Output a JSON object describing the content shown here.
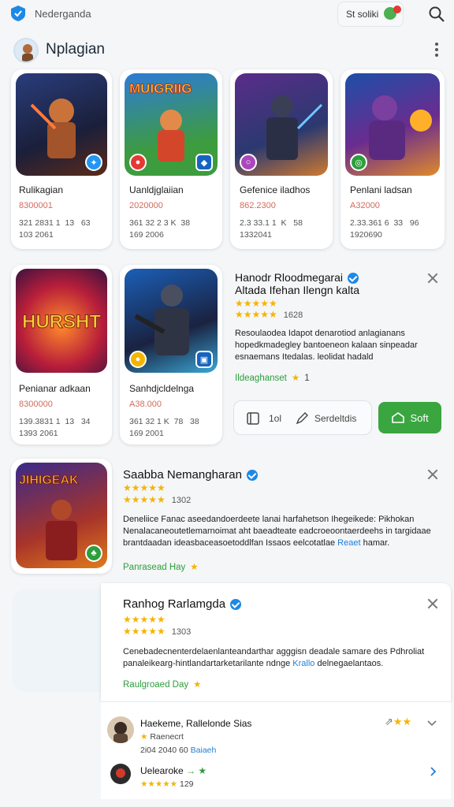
{
  "topbar": {
    "app_name": "Nederganda",
    "pill_label": "St soliki",
    "colors": {
      "accent": "#1e88e5",
      "green": "#3aa63f"
    }
  },
  "header": {
    "title": "Nplagian"
  },
  "grid": [
    {
      "title": "Rulikagian",
      "sub": "8300001",
      "meta": "321 2831 1  13   63\n103 2061"
    },
    {
      "title": "Uanldjglaiian",
      "sub": "2020000",
      "meta": "361 32 2 3 K  38\n169 2006"
    },
    {
      "title": "Gefenice iladhos",
      "sub": "862.2300",
      "meta": "2.3 33.1 1  K   58\n1332041"
    },
    {
      "title": "Penlani ladsan",
      "sub": "A32000",
      "meta": "2.33.361 6  33   96\n1920690"
    },
    {
      "title": "Penianar adkaan",
      "sub": "8300000",
      "meta": "139.3831 1  13   34\n1393 2061"
    },
    {
      "title": "Sanhdjcldelnga",
      "sub": "A38.000",
      "meta": "361 32 1 K  78   38\n169 2001"
    }
  ],
  "thumb_texts": {
    "t2": "MUIGRIIG",
    "t5": "HURSHT"
  },
  "detail1": {
    "title_line1": "Hanodr Rloodmegarai",
    "title_line2": "Altada Ifehan Ilengn kalta",
    "stars": "★★★★★",
    "stars_row2": "★★★★★",
    "rating_count": "1628",
    "desc": "Resoulaodea Idapot denarotiod anlagianans hopedkmadegley bantoeneon kalaan sinpeadar esnaemans Itedalas. leolidat hadald",
    "tag": "Ildeaghanset",
    "tag_num": "1",
    "action_install": "1ol",
    "action_share": "Serdeltdis",
    "primary_button": "Soft"
  },
  "detail2": {
    "title": "Saabba Nemangharan",
    "thumb_text": "JIHIGEAK",
    "stars": "★★★★★",
    "stars_row2": "★★★★★",
    "rating_count": "1302",
    "desc_a": "Deneliice Fanac aseedandoerdeete lanai harfahetson Ihegeikede: Pikhokan Nenalacaneoutetlemarnoimat aht baeadteate eadcroeoontaerdeehs in targidaae brantdaadan ideasbaceasoetoddlfan Issaos eelcotatlae",
    "desc_link": "Reaet",
    "desc_b": "hamar.",
    "tag": "Panrasead Hay"
  },
  "detail3": {
    "title": "Ranhog Rarlamgda",
    "stars": "★★★★★",
    "stars_row2": "★★★★★",
    "rating_count": "1303",
    "desc_a": "Cenebadecnenterdelaenlanteandarthar agggisn deadale samare des Pdhroliat panaleikearg-hintlandartarketarilante ndnge",
    "desc_link": "Krallo",
    "desc_b": "delnegaelantaos.",
    "tag": "Raulgroaed Day"
  },
  "comments": [
    {
      "name": "Haekeme, Rallelonde Sias",
      "line2": "Raenecrt",
      "line3": "2i04 2040 60",
      "line3_link": "Baiaeh",
      "line2_star": "★",
      "icons": "★★"
    },
    {
      "name": "Uelearoke",
      "dash": "→ ★",
      "stars": "★★★★★",
      "count": "129"
    }
  ]
}
